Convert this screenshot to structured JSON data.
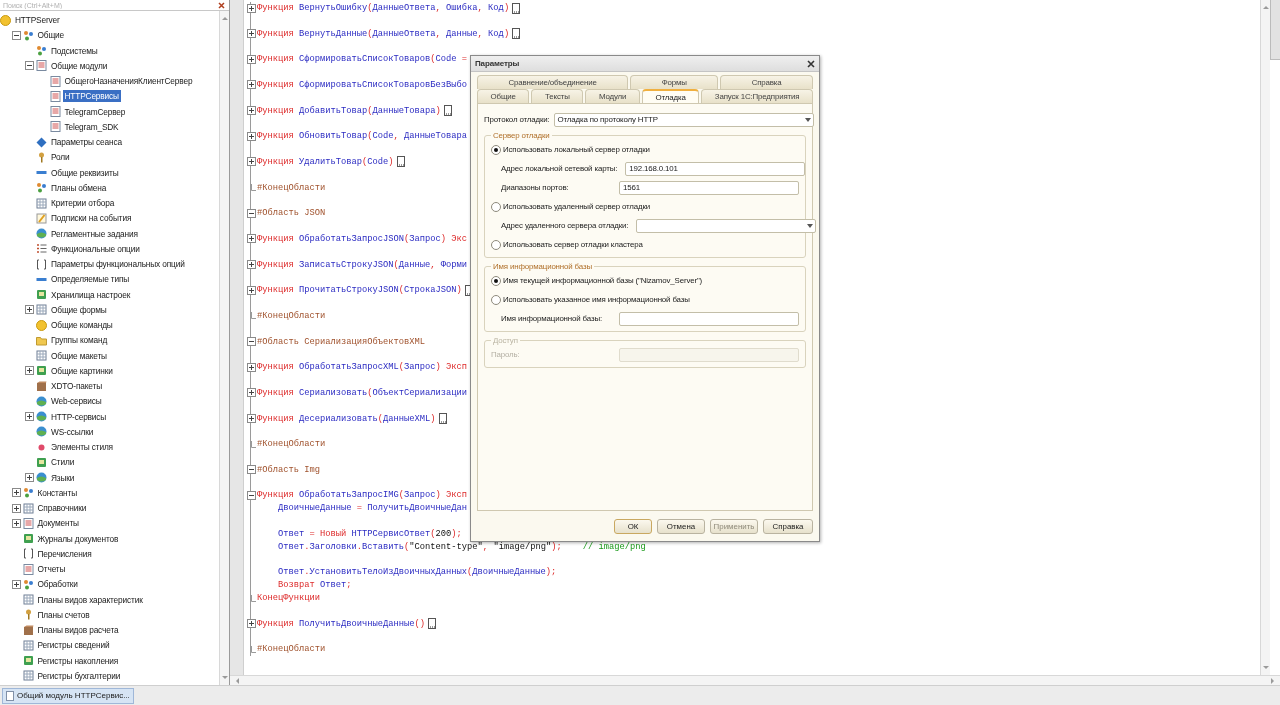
{
  "tree": {
    "search_placeholder": "Поиск (Ctrl+Alt+M)",
    "items": [
      {
        "label": "HTTPServer",
        "selected": false,
        "children": [
          {
            "label": "Общие",
            "expanded": true,
            "selected": false,
            "children": [
              {
                "label": "Подсистемы",
                "selected": false
              },
              {
                "label": "Общие модули",
                "expanded": true,
                "selected": false,
                "children": [
                  {
                    "label": "ОбщегоНазначенияКлиентСервер",
                    "selected": false
                  },
                  {
                    "label": "HTTPСервисы",
                    "selected": true
                  },
                  {
                    "label": "TelegramСервер",
                    "selected": false
                  },
                  {
                    "label": "Telegram_SDK",
                    "selected": false
                  }
                ]
              },
              {
                "label": "Параметры сеанса",
                "selected": false
              },
              {
                "label": "Роли",
                "selected": false
              },
              {
                "label": "Общие реквизиты",
                "selected": false
              },
              {
                "label": "Планы обмена",
                "selected": false
              },
              {
                "label": "Критерии отбора",
                "selected": false
              },
              {
                "label": "Подписки на события",
                "selected": false
              },
              {
                "label": "Регламентные задания",
                "selected": false
              },
              {
                "label": "Функциональные опции",
                "selected": false
              },
              {
                "label": "Параметры функциональных опций",
                "selected": false
              },
              {
                "label": "Определяемые типы",
                "selected": false
              },
              {
                "label": "Хранилища настроек",
                "selected": false
              },
              {
                "label": "Общие формы",
                "expanded": false,
                "selected": false
              },
              {
                "label": "Общие команды",
                "selected": false
              },
              {
                "label": "Группы команд",
                "selected": false
              },
              {
                "label": "Общие макеты",
                "selected": false
              },
              {
                "label": "Общие картинки",
                "expanded": false,
                "selected": false
              },
              {
                "label": "XDTO-пакеты",
                "selected": false
              },
              {
                "label": "Web-сервисы",
                "selected": false
              },
              {
                "label": "HTTP-сервисы",
                "expanded": false,
                "selected": false
              },
              {
                "label": "WS-ссылки",
                "selected": false
              },
              {
                "label": "Элементы стиля",
                "selected": false
              },
              {
                "label": "Стили",
                "selected": false
              },
              {
                "label": "Языки",
                "expanded": false,
                "selected": false
              }
            ]
          },
          {
            "label": "Константы",
            "expanded": false,
            "selected": false
          },
          {
            "label": "Справочники",
            "expanded": false,
            "selected": false
          },
          {
            "label": "Документы",
            "expanded": false,
            "selected": false
          },
          {
            "label": "Журналы документов",
            "selected": false
          },
          {
            "label": "Перечисления",
            "selected": false
          },
          {
            "label": "Отчеты",
            "selected": false
          },
          {
            "label": "Обработки",
            "expanded": false,
            "selected": false
          },
          {
            "label": "Планы видов характеристик",
            "selected": false
          },
          {
            "label": "Планы счетов",
            "selected": false
          },
          {
            "label": "Планы видов расчета",
            "selected": false
          },
          {
            "label": "Регистры сведений",
            "selected": false
          },
          {
            "label": "Регистры накопления",
            "selected": false
          },
          {
            "label": "Регистры бухгалтерии",
            "selected": false
          }
        ]
      }
    ]
  },
  "code": [
    {
      "kind": "code",
      "expanded": false,
      "ellipsis": true,
      "segments": [
        {
          "kind": "kw",
          "text": "Функция "
        },
        {
          "kind": "id",
          "text": "ВернутьОшибку"
        },
        {
          "kind": "op",
          "text": "("
        },
        {
          "kind": "id",
          "text": "ДанныеОтвета"
        },
        {
          "kind": "op",
          "text": ", "
        },
        {
          "kind": "id",
          "text": "Ошибка"
        },
        {
          "kind": "op",
          "text": ", "
        },
        {
          "kind": "id",
          "text": "Код"
        },
        {
          "kind": "op",
          "text": ")"
        }
      ]
    },
    {
      "kind": "blank"
    },
    {
      "kind": "code",
      "expanded": false,
      "ellipsis": true,
      "segments": [
        {
          "kind": "kw",
          "text": "Функция "
        },
        {
          "kind": "id",
          "text": "ВернутьДанные"
        },
        {
          "kind": "op",
          "text": "("
        },
        {
          "kind": "id",
          "text": "ДанныеОтвета"
        },
        {
          "kind": "op",
          "text": ", "
        },
        {
          "kind": "id",
          "text": "Данные"
        },
        {
          "kind": "op",
          "text": ", "
        },
        {
          "kind": "id",
          "text": "Код"
        },
        {
          "kind": "op",
          "text": ")"
        }
      ]
    },
    {
      "kind": "blank"
    },
    {
      "kind": "code",
      "expanded": false,
      "ellipsis": false,
      "segments": [
        {
          "kind": "kw",
          "text": "Функция "
        },
        {
          "kind": "id",
          "text": "СформироватьСписокТоваров"
        },
        {
          "kind": "op",
          "text": "("
        },
        {
          "kind": "id",
          "text": "Code"
        },
        {
          "kind": "op",
          "text": " ="
        }
      ]
    },
    {
      "kind": "blank"
    },
    {
      "kind": "code",
      "expanded": false,
      "ellipsis": false,
      "segments": [
        {
          "kind": "kw",
          "text": "Функция "
        },
        {
          "kind": "id",
          "text": "СформироватьСписокТоваровБезВыбо"
        }
      ]
    },
    {
      "kind": "blank"
    },
    {
      "kind": "code",
      "expanded": false,
      "ellipsis": true,
      "segments": [
        {
          "kind": "kw",
          "text": "Функция "
        },
        {
          "kind": "id",
          "text": "ДобавитьТовар"
        },
        {
          "kind": "op",
          "text": "("
        },
        {
          "kind": "id",
          "text": "ДанныеТовара"
        },
        {
          "kind": "op",
          "text": ")"
        }
      ]
    },
    {
      "kind": "blank"
    },
    {
      "kind": "code",
      "expanded": false,
      "ellipsis": false,
      "segments": [
        {
          "kind": "kw",
          "text": "Функция "
        },
        {
          "kind": "id",
          "text": "ОбновитьТовар"
        },
        {
          "kind": "op",
          "text": "("
        },
        {
          "kind": "id",
          "text": "Code"
        },
        {
          "kind": "op",
          "text": ", "
        },
        {
          "kind": "id",
          "text": "ДанныеТовара"
        }
      ]
    },
    {
      "kind": "blank"
    },
    {
      "kind": "code",
      "expanded": false,
      "ellipsis": true,
      "segments": [
        {
          "kind": "kw",
          "text": "Функция "
        },
        {
          "kind": "id",
          "text": "УдалитьТовар"
        },
        {
          "kind": "op",
          "text": "("
        },
        {
          "kind": "id",
          "text": "Code"
        },
        {
          "kind": "op",
          "text": ")"
        }
      ]
    },
    {
      "kind": "blank"
    },
    {
      "kind": "end",
      "ellipsis": false,
      "segments": [
        {
          "kind": "pre",
          "text": "#КонецОбласти"
        }
      ]
    },
    {
      "kind": "blank"
    },
    {
      "kind": "code",
      "expanded": true,
      "ellipsis": false,
      "segments": [
        {
          "kind": "pre",
          "text": "#Область JSON"
        }
      ]
    },
    {
      "kind": "blank"
    },
    {
      "kind": "code",
      "expanded": false,
      "ellipsis": false,
      "segments": [
        {
          "kind": "kw",
          "text": "Функция "
        },
        {
          "kind": "id",
          "text": "ОбработатьЗапросJSON"
        },
        {
          "kind": "op",
          "text": "("
        },
        {
          "kind": "id",
          "text": "Запрос"
        },
        {
          "kind": "op",
          "text": ") "
        },
        {
          "kind": "kw",
          "text": "Экс"
        }
      ]
    },
    {
      "kind": "blank"
    },
    {
      "kind": "code",
      "expanded": false,
      "ellipsis": false,
      "segments": [
        {
          "kind": "kw",
          "text": "Функция "
        },
        {
          "kind": "id",
          "text": "ЗаписатьСтрокуJSON"
        },
        {
          "kind": "op",
          "text": "("
        },
        {
          "kind": "id",
          "text": "Данные"
        },
        {
          "kind": "op",
          "text": ", "
        },
        {
          "kind": "id",
          "text": "Форми"
        }
      ]
    },
    {
      "kind": "blank"
    },
    {
      "kind": "code",
      "expanded": false,
      "ellipsis": true,
      "segments": [
        {
          "kind": "kw",
          "text": "Функция "
        },
        {
          "kind": "id",
          "text": "ПрочитатьСтрокуJSON"
        },
        {
          "kind": "op",
          "text": "("
        },
        {
          "kind": "id",
          "text": "СтрокаJSON"
        },
        {
          "kind": "op",
          "text": ")"
        }
      ]
    },
    {
      "kind": "blank"
    },
    {
      "kind": "end",
      "ellipsis": false,
      "segments": [
        {
          "kind": "pre",
          "text": "#КонецОбласти"
        }
      ]
    },
    {
      "kind": "blank"
    },
    {
      "kind": "code",
      "expanded": true,
      "ellipsis": false,
      "segments": [
        {
          "kind": "pre",
          "text": "#Область СериализацияОбъектовXML"
        }
      ]
    },
    {
      "kind": "blank"
    },
    {
      "kind": "code",
      "expanded": false,
      "ellipsis": false,
      "segments": [
        {
          "kind": "kw",
          "text": "Функция "
        },
        {
          "kind": "id",
          "text": "ОбработатьЗапросXML"
        },
        {
          "kind": "op",
          "text": "("
        },
        {
          "kind": "id",
          "text": "Запрос"
        },
        {
          "kind": "op",
          "text": ") "
        },
        {
          "kind": "kw",
          "text": "Эксп"
        }
      ]
    },
    {
      "kind": "blank"
    },
    {
      "kind": "code",
      "expanded": false,
      "ellipsis": false,
      "segments": [
        {
          "kind": "kw",
          "text": "Функция "
        },
        {
          "kind": "id",
          "text": "Сериализовать"
        },
        {
          "kind": "op",
          "text": "("
        },
        {
          "kind": "id",
          "text": "ОбъектСериализации"
        }
      ]
    },
    {
      "kind": "blank"
    },
    {
      "kind": "code",
      "expanded": false,
      "ellipsis": true,
      "segments": [
        {
          "kind": "kw",
          "text": "Функция "
        },
        {
          "kind": "id",
          "text": "Десериализовать"
        },
        {
          "kind": "op",
          "text": "("
        },
        {
          "kind": "id",
          "text": "ДанныеXML"
        },
        {
          "kind": "op",
          "text": ")"
        }
      ]
    },
    {
      "kind": "blank"
    },
    {
      "kind": "end",
      "ellipsis": false,
      "segments": [
        {
          "kind": "pre",
          "text": "#КонецОбласти"
        }
      ]
    },
    {
      "kind": "blank"
    },
    {
      "kind": "code",
      "expanded": true,
      "ellipsis": false,
      "segments": [
        {
          "kind": "pre",
          "text": "#Область Img"
        }
      ]
    },
    {
      "kind": "blank"
    },
    {
      "kind": "code",
      "expanded": true,
      "ellipsis": false,
      "segments": [
        {
          "kind": "kw",
          "text": "Функция "
        },
        {
          "kind": "id",
          "text": "ОбработатьЗапросIMG"
        },
        {
          "kind": "op",
          "text": "("
        },
        {
          "kind": "id",
          "text": "Запрос"
        },
        {
          "kind": "op",
          "text": ") "
        },
        {
          "kind": "kw",
          "text": "Эксп"
        }
      ]
    },
    {
      "kind": "body",
      "ellipsis": false,
      "segments": [
        {
          "kind": "id",
          "text": "ДвоичныеДанные"
        },
        {
          "kind": "op",
          "text": " = "
        },
        {
          "kind": "id",
          "text": "ПолучитьДвоичныеДан"
        }
      ]
    },
    {
      "kind": "blank"
    },
    {
      "kind": "body",
      "ellipsis": false,
      "segments": [
        {
          "kind": "id",
          "text": "Ответ"
        },
        {
          "kind": "op",
          "text": " = "
        },
        {
          "kind": "kw",
          "text": "Новый "
        },
        {
          "kind": "id",
          "text": "HTTPСервисОтвет"
        },
        {
          "kind": "op",
          "text": "("
        },
        {
          "kind": "lit",
          "text": "200"
        },
        {
          "kind": "op",
          "text": ");"
        }
      ]
    },
    {
      "kind": "body",
      "ellipsis": false,
      "segments": [
        {
          "kind": "id",
          "text": "Ответ"
        },
        {
          "kind": "op",
          "text": "."
        },
        {
          "kind": "id",
          "text": "Заголовки"
        },
        {
          "kind": "op",
          "text": "."
        },
        {
          "kind": "id",
          "text": "Вставить"
        },
        {
          "kind": "op",
          "text": "("
        },
        {
          "kind": "lit",
          "text": "\"Content-type\""
        },
        {
          "kind": "op",
          "text": ", "
        },
        {
          "kind": "lit",
          "text": "\"image/png\""
        },
        {
          "kind": "op",
          "text": ");"
        },
        {
          "kind": "com",
          "text": "    // image/png"
        }
      ]
    },
    {
      "kind": "blank"
    },
    {
      "kind": "body",
      "ellipsis": false,
      "segments": [
        {
          "kind": "id",
          "text": "Ответ"
        },
        {
          "kind": "op",
          "text": "."
        },
        {
          "kind": "id",
          "text": "УстановитьТелоИзДвоичныхДанных"
        },
        {
          "kind": "op",
          "text": "("
        },
        {
          "kind": "id",
          "text": "ДвоичныеДанные"
        },
        {
          "kind": "op",
          "text": ");"
        }
      ]
    },
    {
      "kind": "body",
      "ellipsis": false,
      "segments": [
        {
          "kind": "kw",
          "text": "Возврат "
        },
        {
          "kind": "id",
          "text": "Ответ"
        },
        {
          "kind": "op",
          "text": ";"
        }
      ]
    },
    {
      "kind": "end",
      "ellipsis": false,
      "segments": [
        {
          "kind": "kw",
          "text": "КонецФункции"
        }
      ]
    },
    {
      "kind": "blank"
    },
    {
      "kind": "code",
      "expanded": false,
      "ellipsis": true,
      "segments": [
        {
          "kind": "kw",
          "text": "Функция "
        },
        {
          "kind": "id",
          "text": "ПолучитьДвоичныеДанные"
        },
        {
          "kind": "op",
          "text": "()"
        }
      ]
    },
    {
      "kind": "blank"
    },
    {
      "kind": "end",
      "ellipsis": false,
      "segments": [
        {
          "kind": "pre",
          "text": "#КонецОбласти"
        }
      ]
    }
  ],
  "dialog": {
    "title": "Параметры",
    "tab_rows": [
      [
        {
          "label": "Сравнение/объединение",
          "selected": false
        },
        {
          "label": "Формы",
          "selected": false
        },
        {
          "label": "Справка",
          "selected": false
        }
      ],
      [
        {
          "label": "Общие",
          "selected": false
        },
        {
          "label": "Тексты",
          "selected": false
        },
        {
          "label": "Модули",
          "selected": false
        },
        {
          "label": "Отладка",
          "selected": true
        },
        {
          "label": "Запуск 1С:Предприятия",
          "selected": false
        }
      ]
    ],
    "protocol": {
      "label": "Протокол отладки:",
      "value": "Отладка по протоколу HTTP"
    },
    "groups": [
      {
        "title": "Сервер отладки",
        "disabled": false,
        "rows": [
          {
            "kind": "radio",
            "label": "Использовать локальный сервер отладки",
            "selected": true
          },
          {
            "kind": "field",
            "label": "Адрес локальной сетевой карты:",
            "value": "192.168.0.101"
          },
          {
            "kind": "field",
            "label": "Диапазоны портов:",
            "value": "1561"
          },
          {
            "kind": "radio",
            "label": "Использовать удаленный сервер отладки",
            "selected": false
          },
          {
            "kind": "combo",
            "label": "Адрес удаленного сервера отладки:"
          },
          {
            "kind": "radio",
            "label": "Использовать сервер отладки кластера",
            "selected": false
          }
        ]
      },
      {
        "title": "Имя информационной базы",
        "disabled": false,
        "rows": [
          {
            "kind": "radio",
            "label": "Имя текущей информационной базы (\"Nizamov_Server\")",
            "selected": true
          },
          {
            "kind": "radio",
            "label": "Использовать указанное имя информационной базы",
            "selected": false
          },
          {
            "kind": "field",
            "label": "Имя информационной базы:"
          }
        ]
      },
      {
        "title": "Доступ",
        "disabled": true,
        "rows": [
          {
            "kind": "field",
            "label": "Пароль:"
          }
        ]
      }
    ],
    "buttons": [
      {
        "label": "ОК",
        "default": true,
        "disabled": false
      },
      {
        "label": "Отмена",
        "default": false,
        "disabled": false
      },
      {
        "label": "Применить",
        "default": false,
        "disabled": true
      },
      {
        "label": "Справка",
        "default": false,
        "disabled": false
      }
    ]
  },
  "status_bar": {
    "window_tab": "Общий модуль HTTPСервис..."
  }
}
